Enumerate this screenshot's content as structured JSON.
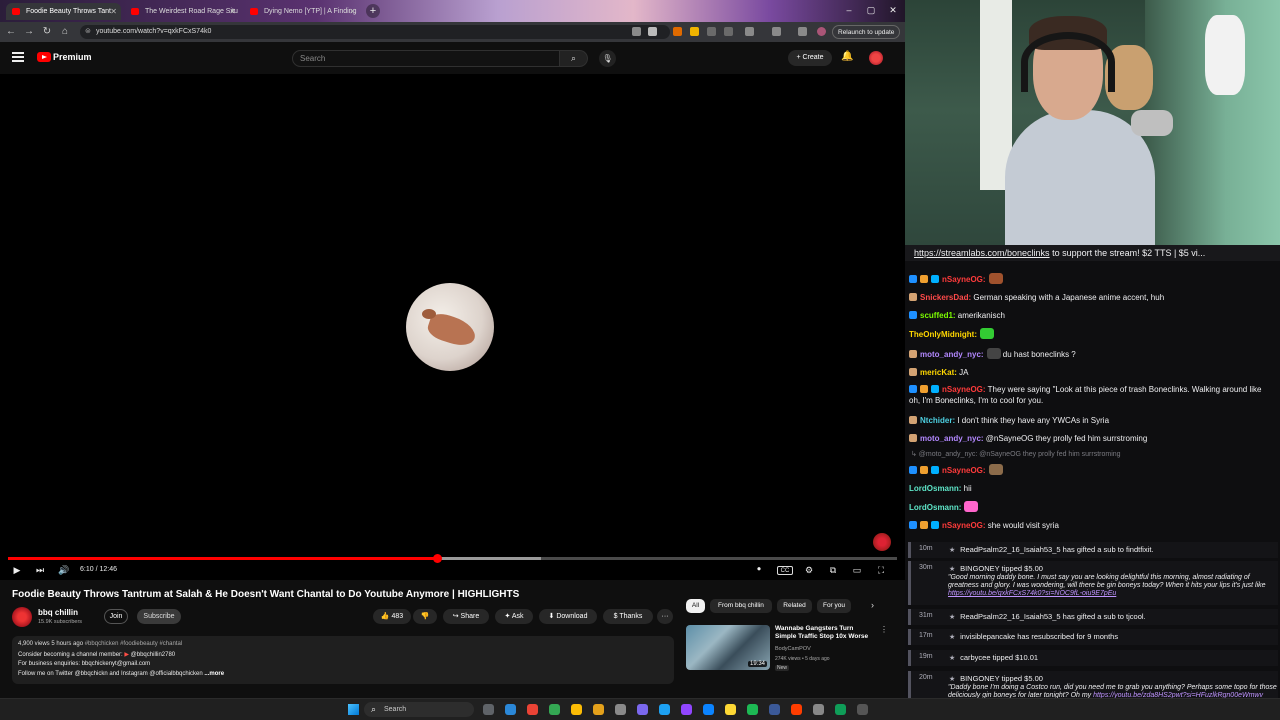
{
  "browser": {
    "tabs": [
      {
        "label": "Foodie Beauty Throws Tant",
        "active": true
      },
      {
        "label": "The Weirdest Road Rage Situ",
        "active": false
      },
      {
        "label": "Dying Nemo [YTP] | A Finding",
        "active": false
      }
    ],
    "new_tab": "+",
    "url": "youtube.com/watch?v=qxkFCxS74k0",
    "relaunch_label": "Relaunch to update",
    "win_min": "–",
    "win_max": "▢",
    "win_close": "✕",
    "nav_back": "←",
    "nav_forward": "→",
    "nav_reload": "↻",
    "nav_home": "⌂"
  },
  "youtube": {
    "brand": "Premium",
    "search_placeholder": "Search",
    "search_icon": "⌕",
    "mic_icon": "🎙",
    "create_label": "+ Create",
    "bell_icon": "🔔",
    "player": {
      "time": "6:10 / 12:46",
      "progress_fraction": 0.483,
      "buffer_fraction": 0.6,
      "play_icon": "▶",
      "next_icon": "⏭",
      "volume_icon": "🔊",
      "cc_icon": "CC",
      "settings_icon": "⚙",
      "miniplayer_icon": "⧉",
      "theater_icon": "▭",
      "fullscreen_icon": "⛶"
    },
    "video": {
      "title": "Foodie Beauty Throws Tantrum at Salah & He Doesn't Want Chantal to Do Youtube Anymore | HIGHLIGHTS",
      "channel": "bbq chillin",
      "subscribers": "15.9K subscribers",
      "join": "Join",
      "subscribe": "Subscribe",
      "likes": "👍 483",
      "dislike": "👎",
      "share": "↪ Share",
      "ask": "✦ Ask",
      "download": "⬇ Download",
      "thanks": "$ Thanks",
      "more": "···",
      "description": {
        "stats": "4,900 views  5 hours ago",
        "hashtags": "#bbqchicken #foodiebeauty #chantal",
        "line1_prefix": "Consider becoming a channel member: ",
        "line1_handle": "@bbqchillin2780",
        "line2": "For business enquiries: bbqchickenyt@gmail.com",
        "line3": "Follow me on Twitter @bbqchickn and Instagram @officialbbqchicken",
        "more": "...more"
      }
    },
    "chips": [
      "All",
      "From bbq chillin",
      "Related",
      "For you"
    ],
    "chip_next": "›",
    "recommendation": {
      "title": "Wannabe Gangsters Turn Simple Traffic Stop 10x Worse",
      "channel": "BodyCamPOV",
      "meta": "274K views • 5 days ago",
      "badge": "New",
      "duration": "19:34",
      "menu": "⋮"
    }
  },
  "chat": {
    "banner_link": "https://streamlabs.com/boneclinks",
    "banner_text": " to support the stream! $2 TTS | $5 vi...",
    "messages": [
      {
        "user": "nSayneOG",
        "color": "#ff3b3b",
        "text": "",
        "emote": "#a0522d",
        "badges": [
          "#1e90ff",
          "#f0a030",
          "#00b0ff"
        ]
      },
      {
        "user": "SnickersDad",
        "color": "#ff4a4a",
        "text": "German speaking with a Japanese anime accent, huh",
        "badges": [
          "#d4a373"
        ]
      },
      {
        "user": "scuffed1",
        "color": "#7cfc00",
        "text": "amerikanisch",
        "badges": [
          "#1e90ff"
        ]
      },
      {
        "user": "TheOnlyMidnight",
        "color": "#ffd700",
        "text": "",
        "emote": "#33cc33",
        "badges": []
      },
      {
        "user": "moto_andy_nyc",
        "color": "#b388ff",
        "text": "du hast boneclinks ?",
        "emote": "#444",
        "badges": [
          "#d4a373"
        ]
      },
      {
        "user": "mericKat",
        "color": "#ffd700",
        "text": "JA",
        "badges": [
          "#d4a373"
        ]
      },
      {
        "user": "nSayneOG",
        "color": "#ff3b3b",
        "text": "They were saying \"Look at this piece of trash Boneclinks. Walking around like oh, I'm Boneclinks, I'm to cool for you.",
        "badges": [
          "#1e90ff",
          "#f0a030",
          "#00b0ff"
        ]
      },
      {
        "user": "Ntchider",
        "color": "#4dd0e1",
        "text": "I don't think they have any YWCAs in Syria",
        "badges": [
          "#d4a373"
        ]
      },
      {
        "user": "moto_andy_nyc",
        "color": "#b388ff",
        "text": "@nSayneOG they prolly fed him surrstroming",
        "badges": [
          "#d4a373"
        ]
      },
      {
        "user": "nSayneOG",
        "color": "#ff3b3b",
        "text": "",
        "emote": "#8b6b4a",
        "badges": [
          "#1e90ff",
          "#f0a030",
          "#00b0ff"
        ]
      },
      {
        "user": "LordOsmann",
        "color": "#5ee6c8",
        "text": "hii",
        "badges": []
      },
      {
        "user": "LordOsmann",
        "color": "#5ee6c8",
        "text": "",
        "emote": "#ff66cc",
        "badges": []
      },
      {
        "user": "nSayneOG",
        "color": "#ff3b3b",
        "text": "she would visit syria",
        "badges": [
          "#1e90ff",
          "#f0a030",
          "#00b0ff"
        ]
      }
    ],
    "reply_text": "@moto_andy_nyc: @nSayneOG they prolly fed him surrstroming",
    "events": [
      {
        "time": "10m",
        "text": "ReadPsalm22_16_Isaiah53_5 has gifted a sub to findtfixit."
      },
      {
        "time": "30m",
        "text": "BINGONEY tipped $5.00",
        "quote": "\"Good morning daddy bone. I must say you are looking delightful this morning, almost radiating of greatness and glory. I was wondering, will there be gin boneys today? When it hits your lips it's just like ",
        "quote_link": "https://youtu.be/qxkFCxS74k0?si=NOC9fL-oiu9E7pEu"
      },
      {
        "time": "31m",
        "text": "ReadPsalm22_16_Isaiah53_5 has gifted a sub to tjcool."
      },
      {
        "time": "17m",
        "text": "invisiblepancake has resubscribed for 9 months"
      },
      {
        "time": "19m",
        "text": "carbycee tipped $10.01"
      },
      {
        "time": "20m",
        "text": "BINGONEY tipped $5.00",
        "quote": "\"Daddy bone I'm doing a Costco run, did you need me to grab you anything? Perhaps some topo for those deliciously gin boneys for later tonight? Oh my ",
        "quote_link": "https://youtu.be/zda8HS2pwt?si=HFuzlkRgn00eWmwv"
      }
    ]
  },
  "taskbar": {
    "search_label": "Search",
    "icon_colors": [
      "#5f6368",
      "#2b88d8",
      "#ea4335",
      "#34a853",
      "#fbbc05",
      "#e4a11b",
      "#8a8a8a",
      "#7b68ee",
      "#1da1f2",
      "#9146ff",
      "#0b84ff",
      "#fdd835",
      "#1db954",
      "#3b5998",
      "#ff3d00",
      "#888",
      "#0f9d58",
      "#555"
    ]
  },
  "colors": {
    "yt_red": "#ff0000",
    "bg": "#0f0f0f",
    "chat_bg": "#0e0e10"
  }
}
